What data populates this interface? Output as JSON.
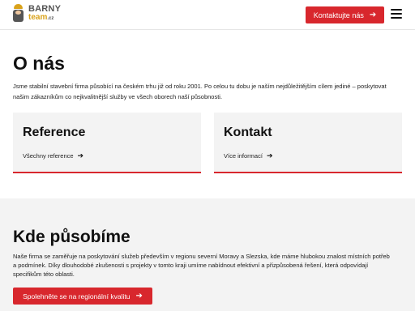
{
  "header": {
    "logo": {
      "word_top": "BARNY",
      "word_bottom": "team",
      "tld": ".cz"
    },
    "contact_button": "Kontaktujte nás",
    "contact_arrow": "➔",
    "menu_icon": "hamburger-icon"
  },
  "about": {
    "title": "O nás",
    "text": "Jsme stabilní stavební firma působící na českém trhu již od roku 2001. Po celou tu dobu je naším nejdůležitějším cílem jediné – poskytovat našim zákazníkům co nejkvalitnější služby ve všech oborech naší působnosti.",
    "cards": [
      {
        "title": "Reference",
        "link": "Všechny reference",
        "arrow": "➔"
      },
      {
        "title": "Kontakt",
        "link": "Více informací",
        "arrow": "➔"
      }
    ]
  },
  "where": {
    "title": "Kde působíme",
    "text": "Naše firma se zaměřuje na poskytování služeb především v regionu severní Moravy a Slezska, kde máme hlubokou znalost místních potřeb a podmínek. Díky dlouhodobé zkušenosti s projekty v tomto kraji umíme nabídnout efektivní a přizpůsobená řešení, která odpovídají specifikům této oblasti.",
    "button": "Spolehněte se na regionální kvalitu",
    "button_arrow": "➔"
  },
  "colors": {
    "accent": "#d8272d",
    "panel": "#f3f3f3",
    "logo_gold": "#d9a21b"
  }
}
